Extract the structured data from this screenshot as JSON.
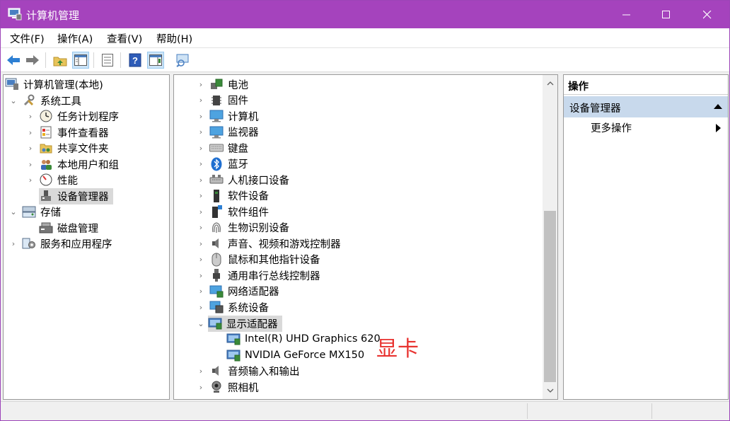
{
  "window": {
    "title": "计算机管理"
  },
  "menubar": [
    {
      "label": "文件(F)"
    },
    {
      "label": "操作(A)"
    },
    {
      "label": "查看(V)"
    },
    {
      "label": "帮助(H)"
    }
  ],
  "left_tree": {
    "root": "计算机管理(本地)",
    "system_tools": "系统工具",
    "task_scheduler": "任务计划程序",
    "event_viewer": "事件查看器",
    "shared_folders": "共享文件夹",
    "local_users": "本地用户和组",
    "performance": "性能",
    "device_manager": "设备管理器",
    "storage": "存储",
    "disk_management": "磁盘管理",
    "services_apps": "服务和应用程序"
  },
  "device_tree": {
    "categories": [
      {
        "label": "电池",
        "icon": "battery-icon"
      },
      {
        "label": "固件",
        "icon": "firmware-icon"
      },
      {
        "label": "计算机",
        "icon": "computer-icon"
      },
      {
        "label": "监视器",
        "icon": "monitor-icon"
      },
      {
        "label": "键盘",
        "icon": "keyboard-icon"
      },
      {
        "label": "蓝牙",
        "icon": "bluetooth-icon"
      },
      {
        "label": "人机接口设备",
        "icon": "hid-icon"
      },
      {
        "label": "软件设备",
        "icon": "software-device-icon"
      },
      {
        "label": "软件组件",
        "icon": "software-component-icon"
      },
      {
        "label": "生物识别设备",
        "icon": "fingerprint-icon"
      },
      {
        "label": "声音、视频和游戏控制器",
        "icon": "speaker-icon"
      },
      {
        "label": "鼠标和其他指针设备",
        "icon": "mouse-icon"
      },
      {
        "label": "通用串行总线控制器",
        "icon": "usb-icon"
      },
      {
        "label": "网络适配器",
        "icon": "network-adapter-icon"
      },
      {
        "label": "系统设备",
        "icon": "system-device-icon"
      }
    ],
    "display_adapters": "显示适配器",
    "gpu_1": "Intel(R) UHD Graphics 620",
    "gpu_2": "NVIDIA GeForce MX150",
    "audio_io": "音频输入和输出",
    "camera": "照相机",
    "annotation": "显卡"
  },
  "actions": {
    "header": "操作",
    "group": "设备管理器",
    "more": "更多操作"
  },
  "colors": {
    "titlebar": "#a543bd",
    "annotation": "#e8322f",
    "action_group_bg": "#c8d9ec"
  }
}
